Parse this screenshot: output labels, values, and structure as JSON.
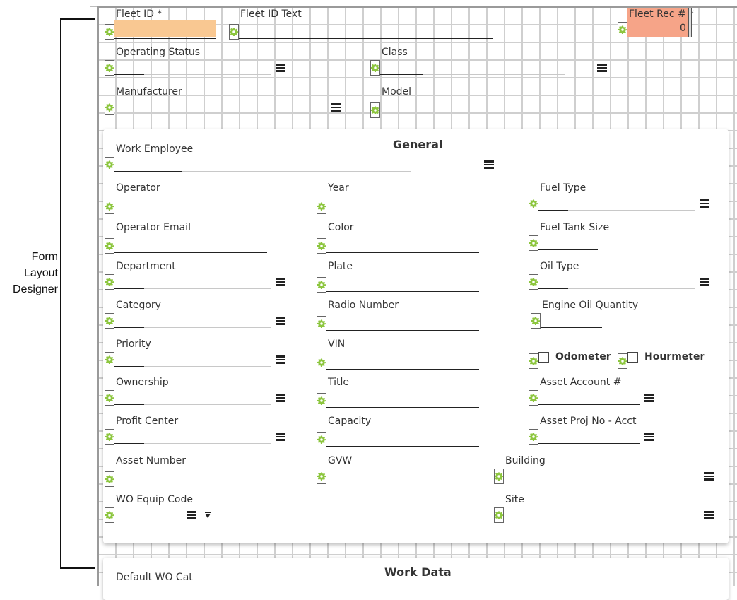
{
  "annotation": {
    "label_line1": "Form",
    "label_line2": "Layout",
    "label_line3": "Designer"
  },
  "colors": {
    "required_field_bg": "#F9C892",
    "recnum_field_bg": "#F6A488",
    "gear": "#8DC63F"
  },
  "header_fields": {
    "fleet_id": "Fleet ID *",
    "fleet_id_text": "Fleet ID Text",
    "fleet_rec": "Fleet Rec # *",
    "fleet_rec_value": "0",
    "operating_status": "Operating Status",
    "class": "Class",
    "manufacturer": "Manufacturer",
    "model": "Model"
  },
  "general": {
    "title": "General",
    "work_employee": "Work Employee",
    "operator": "Operator",
    "operator_email": "Operator Email",
    "department": "Department",
    "category": "Category",
    "priority": "Priority",
    "ownership": "Ownership",
    "profit_center": "Profit Center",
    "asset_number": "Asset Number",
    "wo_equip_code": "WO Equip Code",
    "year": "Year",
    "color": "Color",
    "plate": "Plate",
    "radio_number": "Radio Number",
    "vin": "VIN",
    "title_field": "Title",
    "capacity": "Capacity",
    "gvw": "GVW",
    "fuel_type": "Fuel Type",
    "fuel_tank_size": "Fuel Tank Size",
    "oil_type": "Oil Type",
    "engine_oil_quantity": "Engine Oil Quantity",
    "odometer": "Odometer",
    "hourmeter": "Hourmeter",
    "asset_account": "Asset Account #",
    "asset_proj": "Asset Proj No - Acct",
    "building": "Building",
    "site": "Site"
  },
  "work_data": {
    "title": "Work Data",
    "default_wo_cat": "Default WO Cat"
  }
}
